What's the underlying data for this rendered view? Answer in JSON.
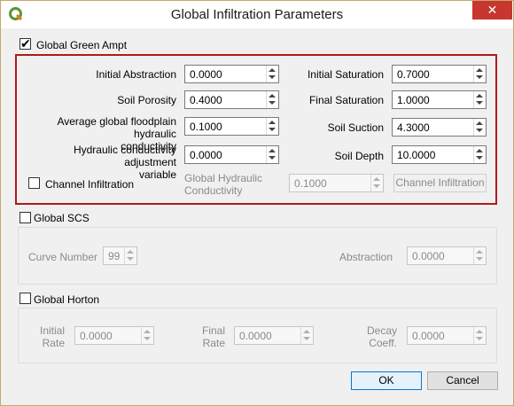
{
  "window": {
    "title": "Global Infiltration Parameters",
    "close_glyph": "✕"
  },
  "green_ampt": {
    "checkbox_label": "Global Green Ampt",
    "checked": true,
    "initial_abstraction": {
      "label": "Initial Abstraction",
      "value": "0.0000"
    },
    "soil_porosity": {
      "label": "Soil Porosity",
      "value": "0.4000"
    },
    "avg_floodplain_conductivity": {
      "label_line1": "Average global floodplain hydraulic",
      "label_line2": "conductivity",
      "value": "0.1000"
    },
    "conductivity_adjustment": {
      "label_line1": "Hydraulic conductivity adjustment",
      "label_line2": "variable",
      "value": "0.0000"
    },
    "initial_saturation": {
      "label": "Initial Saturation",
      "value": "0.7000"
    },
    "final_saturation": {
      "label": "Final Saturation",
      "value": "1.0000"
    },
    "soil_suction": {
      "label": "Soil Suction",
      "value": "4.3000"
    },
    "soil_depth": {
      "label": "Soil Depth",
      "value": "10.0000"
    },
    "channel_infiltration": {
      "checkbox_label": "Channel Infiltration",
      "checked": false
    },
    "global_hydraulic_conductivity": {
      "label_line1": "Global Hydraulic",
      "label_line2": "Conductivity",
      "value": "0.1000"
    },
    "channel_infiltration_button": "Channel Infiltration"
  },
  "scs": {
    "checkbox_label": "Global SCS",
    "checked": false,
    "curve_number": {
      "label": "Curve Number",
      "value": "99"
    },
    "abstraction": {
      "label": "Abstraction",
      "value": "0.0000"
    }
  },
  "horton": {
    "checkbox_label": "Global Horton",
    "checked": false,
    "initial_rate": {
      "label_line1": "Initial",
      "label_line2": "Rate",
      "value": "0.0000"
    },
    "final_rate": {
      "label_line1": "Final",
      "label_line2": "Rate",
      "value": "0.0000"
    },
    "decay_coeff": {
      "label_line1": "Decay",
      "label_line2": "Coeff.",
      "value": "0.0000"
    }
  },
  "buttons": {
    "ok": "OK",
    "cancel": "Cancel"
  },
  "colors": {
    "highlight_border": "#b01a1a",
    "close_button": "#c7372f",
    "default_button_border": "#0078d7"
  }
}
